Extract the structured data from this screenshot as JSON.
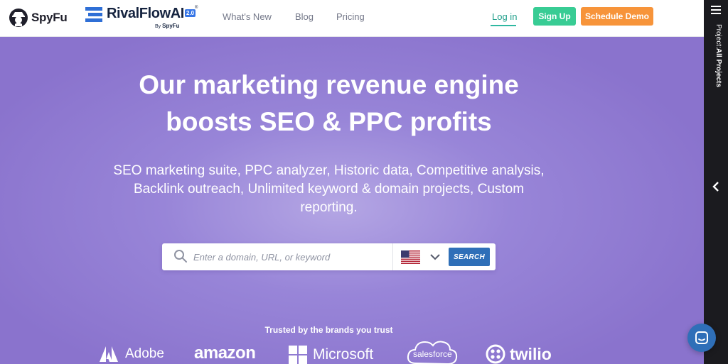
{
  "header": {
    "spyfu_logo_text": "SpyFu",
    "rivalflow_logo": {
      "name": "RivalFlowAI",
      "version": "2.0",
      "byline_prefix": "By",
      "byline_brand": "SpyFu",
      "registered": "®"
    },
    "nav": [
      {
        "label": "What's New"
      },
      {
        "label": "Blog"
      },
      {
        "label": "Pricing"
      }
    ],
    "login_label": "Log in",
    "signup_label": "Sign Up",
    "demo_label": "Schedule Demo"
  },
  "hero": {
    "title_line1": "Our marketing revenue engine",
    "title_line2": "boosts SEO & PPC profits",
    "subtitle_line1": "SEO marketing suite, PPC analyzer, Historic data, Competitive analysis,",
    "subtitle_line2": "Backlink outreach, Unlimited keyword & domain projects, Custom",
    "subtitle_line3": "reporting."
  },
  "search": {
    "placeholder": "Enter a domain, URL, or keyword",
    "value": "",
    "country_icon": "us-flag-icon",
    "button_label": "SEARCH"
  },
  "brands": {
    "heading": "Trusted by the brands you trust",
    "items": [
      "Adobe",
      "amazon",
      "Microsoft",
      "salesforce",
      "twilio"
    ]
  },
  "side_panel": {
    "label_prefix": "Project:",
    "label_value": "All Projects"
  },
  "colors": {
    "hero_bg": "#8a73cd",
    "signup": "#38cc94",
    "demo": "#f7943a",
    "search_button": "#2f6fb8",
    "login": "#1e9e8a",
    "side_panel": "#1b1b1f"
  },
  "icons": {
    "spyfu": "spyfu-spy-icon",
    "rivalflow": "rivalflow-bars-icon",
    "search": "search-icon",
    "chevron": "chevron-down-icon",
    "menu": "hamburger-icon",
    "collapse": "chevron-left-icon",
    "chat": "chat-icon"
  }
}
